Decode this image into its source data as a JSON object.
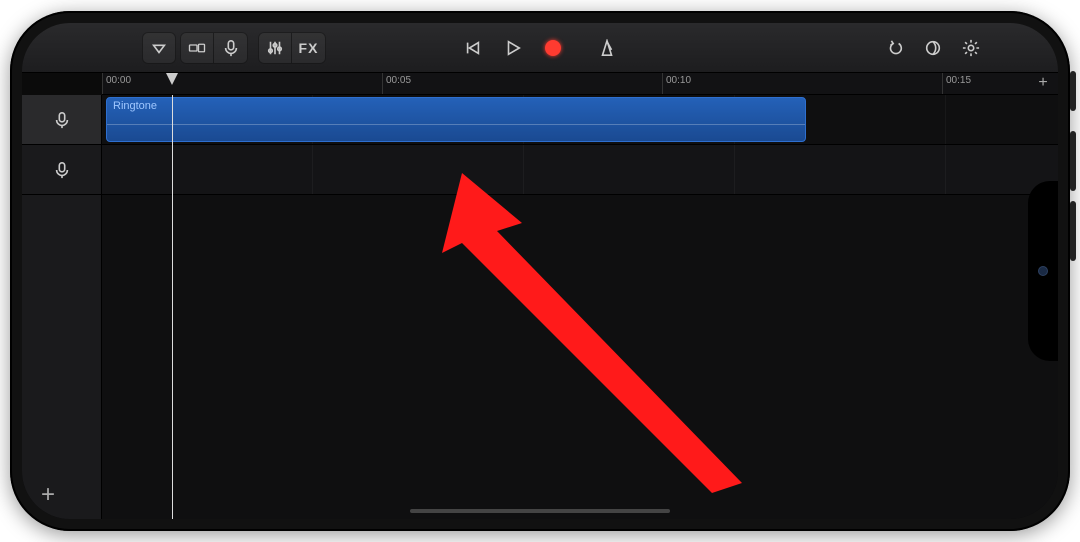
{
  "toolbar": {
    "fx_label": "FX"
  },
  "ruler": {
    "labels": [
      "00:00",
      "00:05",
      "00:10",
      "00:15"
    ]
  },
  "tracks": {
    "region_label": "Ringtone"
  }
}
